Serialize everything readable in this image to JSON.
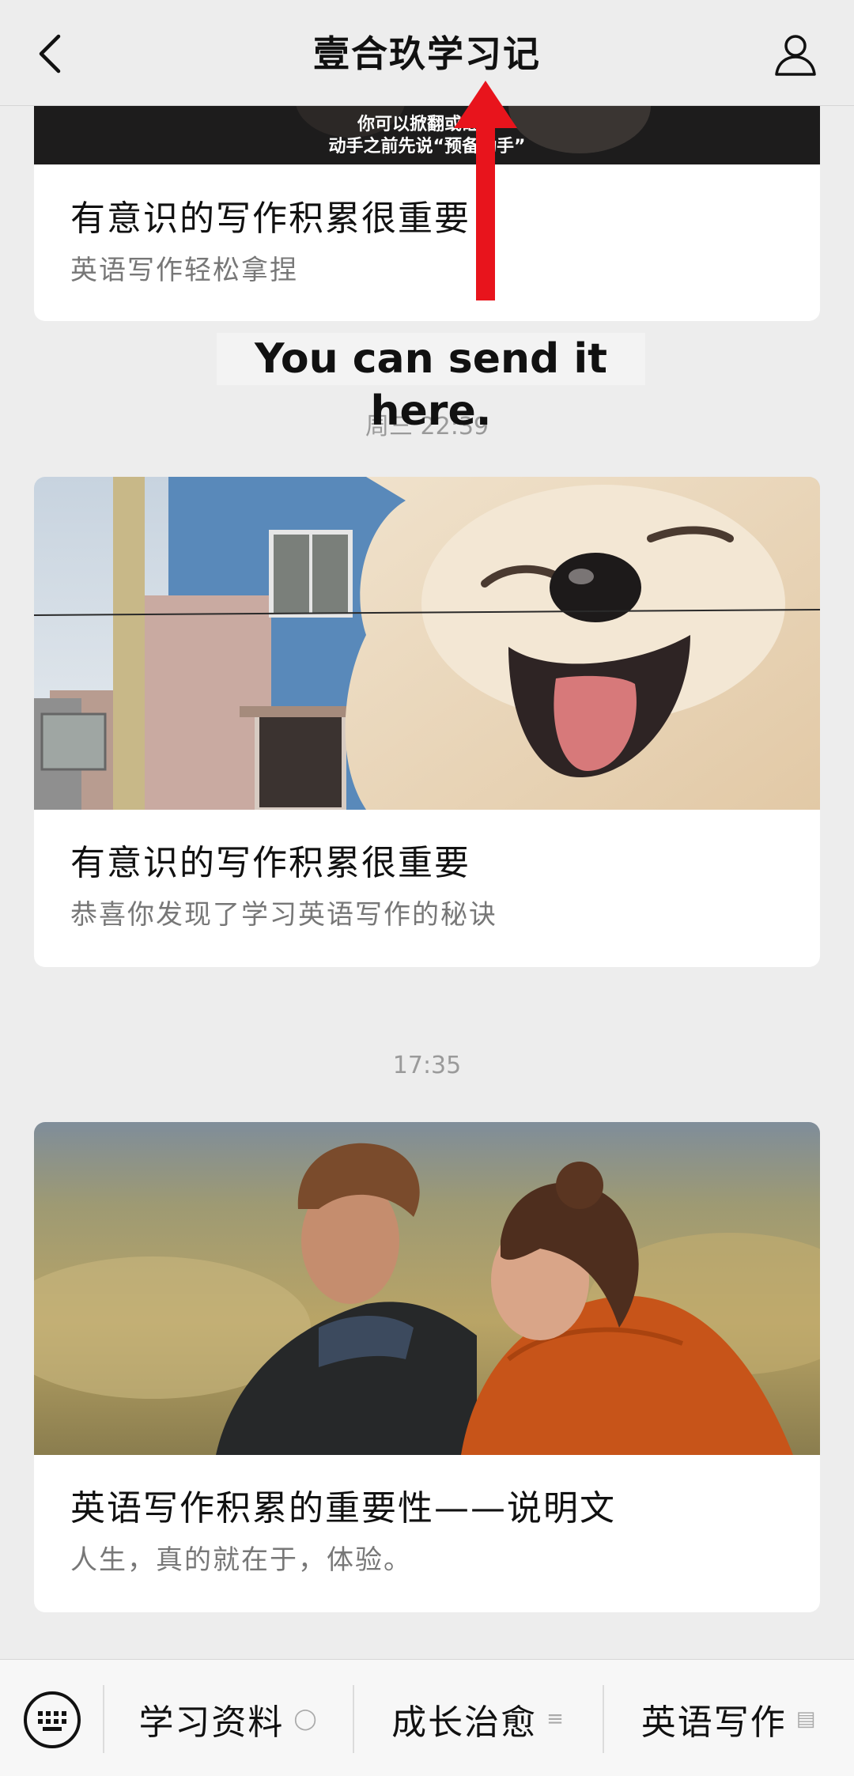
{
  "header": {
    "title": "壹合玖学习记"
  },
  "overlay": {
    "caption": "You can send it here."
  },
  "cards": [
    {
      "image_caption_line1": "你可以掀翻或砸",
      "image_caption_line1b": "子",
      "image_caption_line2": "动手之前先说“预备",
      "image_caption_line2b": "动手”",
      "title": "有意识的写作积累很重要",
      "subtitle": "英语写作轻松拿捏"
    },
    {
      "title": "有意识的写作积累很重要",
      "subtitle": "恭喜你发现了学习英语写作的秘诀"
    },
    {
      "title": "英语写作积累的重要性——说明文",
      "subtitle": "人生，真的就在于，体验。"
    }
  ],
  "timestamps": {
    "t1": "周三 22:39",
    "t2": "17:35"
  },
  "tabbar": {
    "tabs": [
      {
        "label": "学习资料",
        "icon": "chat-bubble-icon"
      },
      {
        "label": "成长治愈",
        "icon": "menu-lines-icon"
      },
      {
        "label": "英语写作",
        "icon": "document-icon"
      }
    ]
  },
  "colors": {
    "background": "#ededed",
    "card": "#ffffff",
    "annotation_arrow": "#e8141c"
  }
}
